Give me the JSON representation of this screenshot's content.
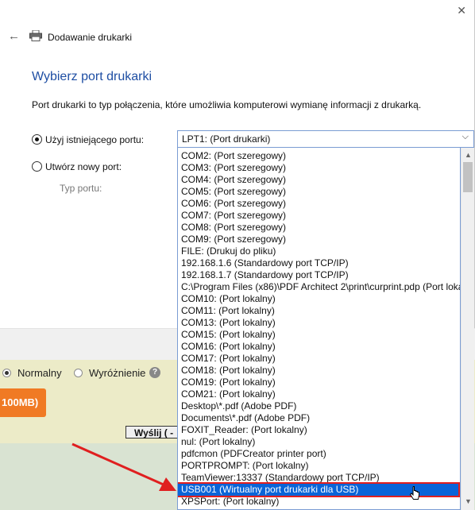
{
  "dialog": {
    "title": "Dodawanie drukarki",
    "heading": "Wybierz port drukarki",
    "description": "Port drukarki to typ połączenia, które umożliwia komputerowi wymianę informacji z drukarką.",
    "use_existing_label": "Użyj istniejącego portu:",
    "create_new_label": "Utwórz nowy port:",
    "port_type_label": "Typ portu:",
    "selected_port": "LPT1: (Port drukarki)",
    "icons": {
      "back": "back-arrow-icon",
      "printer": "printer-icon",
      "close": "close-icon"
    }
  },
  "dropdown": {
    "items": [
      "COM2: (Port szeregowy)",
      "COM3: (Port szeregowy)",
      "COM4: (Port szeregowy)",
      "COM5: (Port szeregowy)",
      "COM6: (Port szeregowy)",
      "COM7: (Port szeregowy)",
      "COM8: (Port szeregowy)",
      "COM9: (Port szeregowy)",
      "FILE: (Drukuj do pliku)",
      "192.168.1.6 (Standardowy port TCP/IP)",
      "192.168.1.7 (Standardowy port TCP/IP)",
      "C:\\Program Files (x86)\\PDF Architect 2\\print\\curprint.pdp (Port lokalny)",
      "COM10: (Port lokalny)",
      "COM11: (Port lokalny)",
      "COM13: (Port lokalny)",
      "COM15: (Port lokalny)",
      "COM16: (Port lokalny)",
      "COM17: (Port lokalny)",
      "COM18: (Port lokalny)",
      "COM19: (Port lokalny)",
      "COM21: (Port lokalny)",
      "Desktop\\*.pdf (Adobe PDF)",
      "Documents\\*.pdf (Adobe PDF)",
      "FOXIT_Reader: (Port lokalny)",
      "nul: (Port lokalny)",
      "pdfcmon (PDFCreator printer port)",
      "PORTPROMPT: (Port lokalny)",
      "TeamViewer:13337 (Standardowy port TCP/IP)",
      "USB001 (Wirtualny port drukarki dla USB)",
      "XPSPort: (Port lokalny)"
    ],
    "selected_item": "USB001 (Wirtualny port drukarki dla USB)"
  },
  "background_page": {
    "radio_normal": "Normalny",
    "radio_highlight": "Wyróżnienie",
    "help_glyph": "?",
    "orange_button": "100MB)",
    "send_button": "Wyślij ( -"
  },
  "colors": {
    "accent": "#1e4ea3",
    "selection": "#0a64d8",
    "highlight_outline": "#e01f1f",
    "orange": "#f07a24"
  }
}
